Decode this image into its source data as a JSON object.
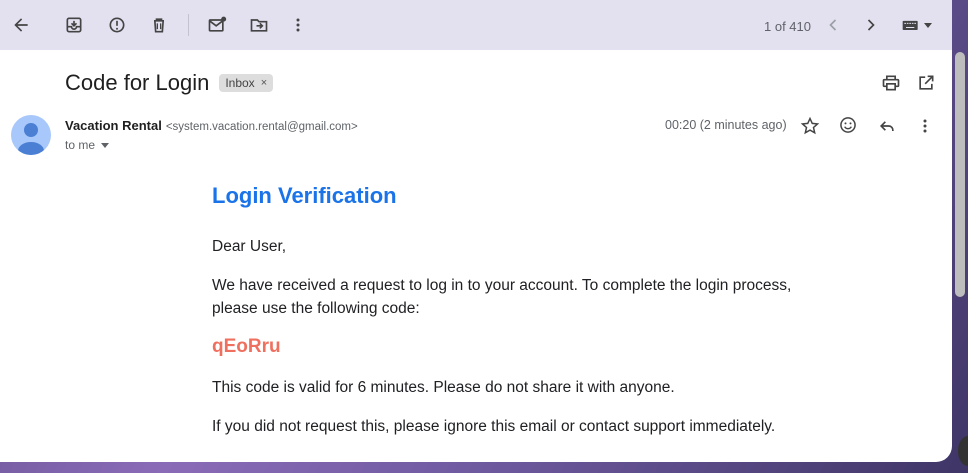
{
  "toolbar": {
    "icons": [
      "back-arrow-icon",
      "archive-icon",
      "report-spam-icon",
      "delete-icon",
      "mark-unread-icon",
      "move-to-icon",
      "more-vert-icon"
    ],
    "pager": "1 of 410"
  },
  "email": {
    "subject": "Code for Login",
    "label": "Inbox",
    "label_close": "×",
    "sender_name": "Vacation Rental",
    "sender_email": "<system.vacation.rental@gmail.com>",
    "recipient": "to me",
    "time": "00:20 (2 minutes ago)"
  },
  "body": {
    "heading": "Login Verification",
    "greeting": "Dear User,",
    "paragraph1": "We have received a request to log in to your account. To complete the login process, please use the following code:",
    "code": "qEoRru",
    "paragraph2": "This code is valid for 6 minutes. Please do not share it with anyone.",
    "paragraph3": "If you did not request this, please ignore this email or contact support immediately."
  },
  "colors": {
    "heading": "#1a73e8",
    "code": "#f07060",
    "toolbar_bg": "#e3e0ef",
    "avatar_bg": "#a8c7fa"
  }
}
